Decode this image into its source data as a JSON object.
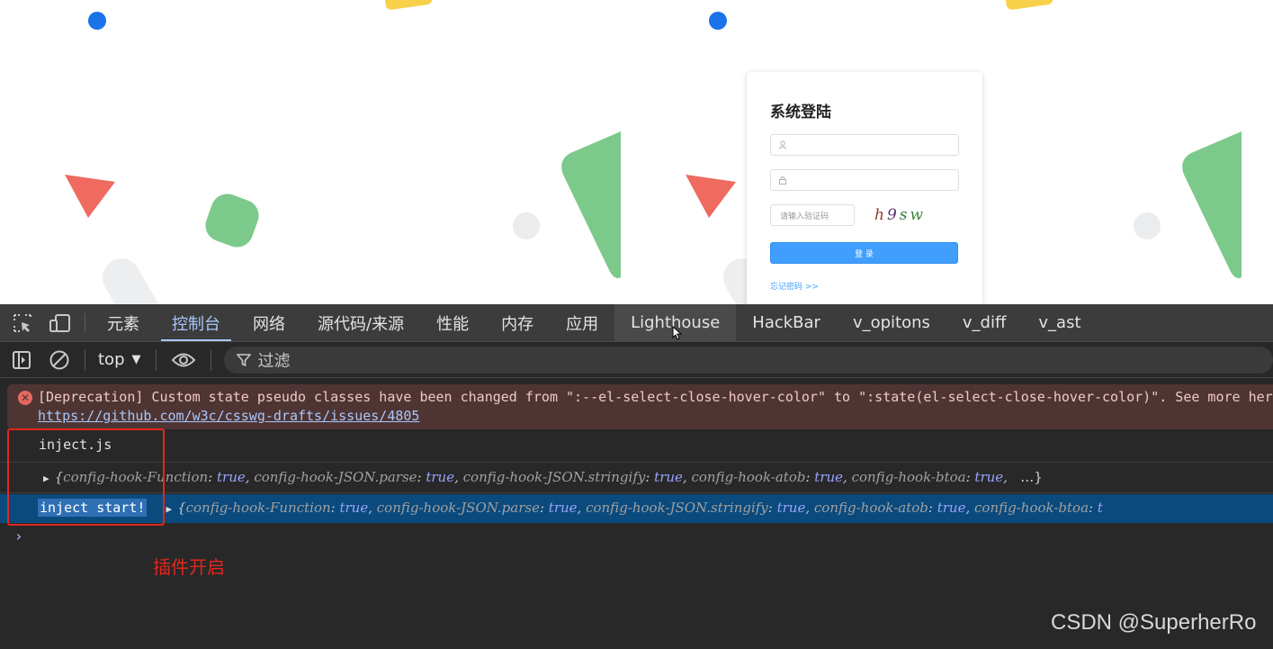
{
  "login": {
    "title": "系统登陆",
    "captcha_placeholder": "请输入验证码",
    "captcha_text": "h9sw",
    "login_button": "登 录",
    "forgot_link": "忘记密码 >>"
  },
  "devtools": {
    "tabs": [
      {
        "label": "元素"
      },
      {
        "label": "控制台"
      },
      {
        "label": "网络"
      },
      {
        "label": "源代码/来源"
      },
      {
        "label": "性能"
      },
      {
        "label": "内存"
      },
      {
        "label": "应用"
      },
      {
        "label": "Lighthouse"
      },
      {
        "label": "HackBar"
      },
      {
        "label": "v_opitons"
      },
      {
        "label": "v_diff"
      },
      {
        "label": "v_ast"
      }
    ],
    "active_tab": "控制台",
    "toolbar": {
      "context": "top",
      "filter_label": "过滤"
    }
  },
  "console": {
    "error": {
      "text": "[Deprecation] Custom state pseudo classes have been changed from \":--el-select-close-hover-color\" to \":state(el-select-close-hover-color)\". See more here:",
      "link": "https://github.com/w3c/csswg-drafts/issues/4805"
    },
    "log1": "inject.js",
    "obj1": {
      "open": "{",
      "k1": "config-hook-Function",
      "v1": "true",
      "k2": "config-hook-JSON.parse",
      "v2": "true",
      "k3": "config-hook-JSON.stringify",
      "v3": "true",
      "k4": "config-hook-atob",
      "v4": "true",
      "k5": "config-hook-btoa",
      "v5": "true",
      "close": "…}"
    },
    "log2": "inject start!",
    "obj2": {
      "open": "{",
      "k1": "config-hook-Function",
      "v1": "true",
      "k2": "config-hook-JSON.parse",
      "v2": "true",
      "k3": "config-hook-JSON.stringify",
      "v3": "true",
      "k4": "config-hook-atob",
      "v4": "true",
      "k5": "config-hook-btoa",
      "v5": "t"
    },
    "prompt": "›"
  },
  "annotation": "插件开启",
  "watermark": "CSDN @SuperherRo"
}
